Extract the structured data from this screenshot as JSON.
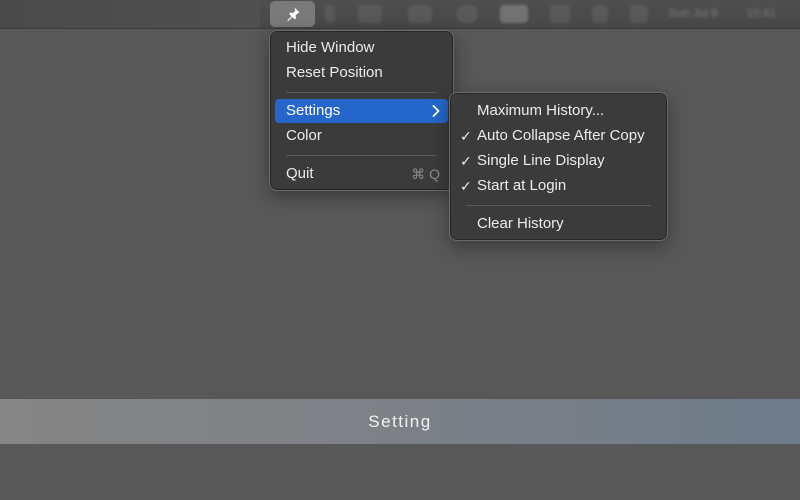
{
  "menubar": {
    "pin_icon": "pushpin-icon",
    "status_icons": [
      "sound-icon",
      "volume-icon",
      "window-icon",
      "circle-icon",
      "display-icon",
      "bluetooth-icon",
      "search-icon",
      "lock-icon"
    ],
    "date_text": "Sun Jul 8",
    "time_text": "10:41"
  },
  "main_menu": {
    "items": [
      {
        "label": "Hide Window"
      },
      {
        "label": "Reset Position"
      },
      {
        "label": "Settings"
      },
      {
        "label": "Color"
      },
      {
        "label": "Quit",
        "shortcut": "⌘ Q"
      }
    ]
  },
  "settings_submenu": {
    "items": [
      {
        "label": "Maximum History...",
        "checked": false
      },
      {
        "label": "Auto Collapse After Copy",
        "checked": true
      },
      {
        "label": "Single Line Display",
        "checked": true
      },
      {
        "label": "Start at Login",
        "checked": true
      },
      {
        "label": "Clear History",
        "checked": false
      }
    ],
    "check_glyph": "✓"
  },
  "banner": {
    "text": "Setting"
  },
  "colors": {
    "highlight": "#2466c9",
    "menu_bg": "#3b3b3b",
    "desktop": "#585858"
  }
}
